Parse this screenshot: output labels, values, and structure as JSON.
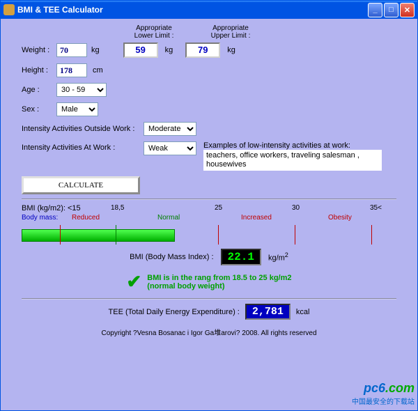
{
  "window": {
    "title": "BMI & TEE Calculator"
  },
  "limits": {
    "lower_label": "Appropriate Lower Limit :",
    "upper_label": "Appropriate Upper Limit :",
    "lower_value": "59",
    "upper_value": "79",
    "unit": "kg"
  },
  "fields": {
    "weight_label": "Weight :",
    "weight_value": "70",
    "weight_unit": "kg",
    "height_label": "Height :",
    "height_value": "178",
    "height_unit": "cm",
    "age_label": "Age :",
    "age_value": "30 - 59",
    "sex_label": "Sex :",
    "sex_value": "Male",
    "outside_label": "Intensity Activities Outside Work :",
    "outside_value": "Moderate",
    "atwork_label": "Intensity Activities At Work :",
    "atwork_value": "Weak",
    "examples_label": "Examples of low-intensity activities at work:",
    "examples_text": "teachers, office workers, traveling salesman , housewives"
  },
  "calculate_label": "CALCULATE",
  "scale": {
    "header": "BMI (kg/m2): <15",
    "n185": "18,5",
    "n25": "25",
    "n30": "30",
    "n35": "35<",
    "body_mass": "Body mass:",
    "reduced": "Reduced",
    "normal": "Normal",
    "increased": "Increased",
    "obesity": "Obesity"
  },
  "bmi": {
    "label": "BMI (Body Mass Index) :",
    "value": "22.1",
    "unit": "kg/m",
    "sup": "2",
    "status_line1": "BMI is in the rang from 18.5 to 25 kg/m2",
    "status_line2": "(normal body weight)"
  },
  "tee": {
    "label": "TEE (Total Daily Energy Expenditure) :",
    "value": "2,781",
    "unit": "kcal"
  },
  "copyright": "Copyright ?Vesna Bosanac i Igor Ga堆arovi? 2008. All rights reserved",
  "watermark": {
    "brand": "pc6",
    "suffix": ".com",
    "tagline": "中国最安全的下载站"
  }
}
